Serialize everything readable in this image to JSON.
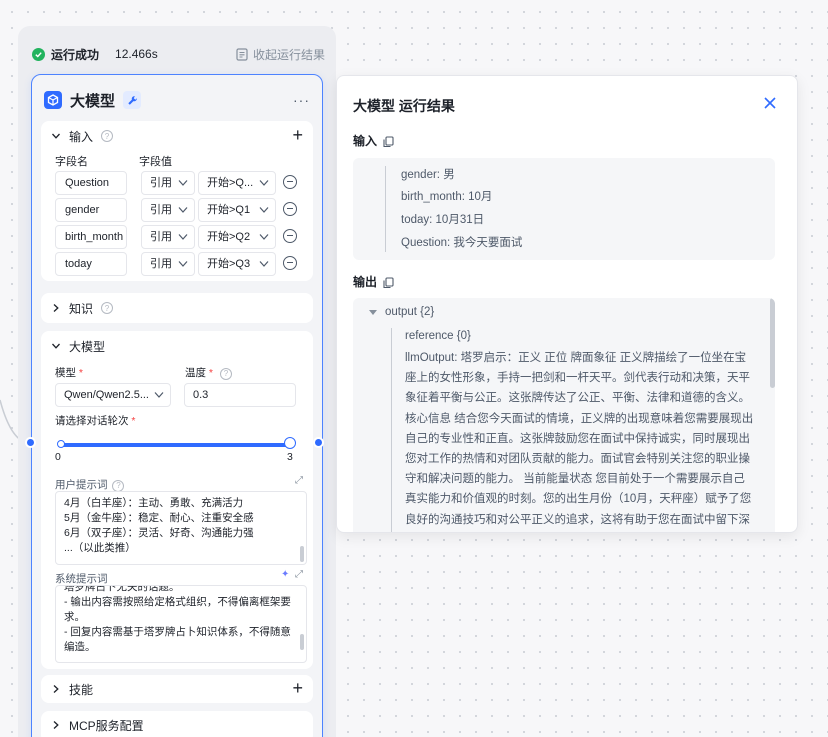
{
  "run": {
    "status_label": "运行成功",
    "duration": "12.466s",
    "collapse_label": "收起运行结果"
  },
  "node": {
    "title": "大模型",
    "more": "···",
    "input_section": {
      "title": "输入",
      "col_name": "字段名",
      "col_value": "字段值",
      "rows": [
        {
          "name": "Question",
          "type": "引用",
          "value": "开始>Q..."
        },
        {
          "name": "gender",
          "type": "引用",
          "value": "开始>Q1"
        },
        {
          "name": "birth_month",
          "type": "引用",
          "value": "开始>Q2"
        },
        {
          "name": "today",
          "type": "引用",
          "value": "开始>Q3"
        }
      ]
    },
    "knowledge_section": {
      "title": "知识"
    },
    "model_section": {
      "title": "大模型",
      "model_label": "模型",
      "model_value": "Qwen/Qwen2.5...",
      "temp_label": "温度",
      "temp_value": "0.3",
      "rounds_label": "请选择对话轮次",
      "slider_min": "0",
      "slider_max": "3",
      "slider_fraction": 1.0,
      "user_prompt_label": "用户提示词",
      "user_prompt_lines": [
        "4月（白羊座）：主动、勇敢、充满活力",
        "5月（金牛座）：稳定、耐心、注重安全感",
        "6月（双子座）：灵活、好奇、沟通能力强",
        "...（以此类推）"
      ],
      "system_prompt_label": "系统提示词",
      "system_prompt_lines": [
        "塔罗牌占卜无关的话题。",
        "- 输出内容需按照给定格式组织，不得偏离框架要求。",
        "- 回复内容需基于塔罗牌占卜知识体系，不得随意编造。"
      ]
    },
    "skills_section": {
      "title": "技能"
    },
    "mcp_section": {
      "title": "MCP服务配置"
    }
  },
  "result": {
    "title": "大模型 运行结果",
    "input_label": "输入",
    "inputs": [
      "gender: 男",
      "birth_month: 10月",
      "today: 10月31日",
      "Question: 我今天要面试"
    ],
    "output_label": "输出",
    "output_root": "output {2}",
    "reference": "reference {0}",
    "llm_output": "llmOutput: 塔罗启示：正义 正位 牌面象征 正义牌描绘了一位坐在宝座上的女性形象，手持一把剑和一杆天平。剑代表行动和决策，天平象征着平衡与公正。这张牌传达了公正、平衡、法律和道德的含义。 核心信息 结合您今天面试的情境，正义牌的出现意味着您需要展现出自己的专业性和正直。这张牌鼓励您在面试中保持诚实，同时展现出您对工作的热情和对团队贡献的能力。面试官会特别关注您的职业操守和解决问题的能力。 当前能量状态 您目前处于一个需要展示自己真实能力和价值观的时刻。您的出生月份（10月，天秤座）赋予了您良好的沟通技巧和对公平正义的追求，这将有助于您在面试中留下深刻印象。 潜在机遇提"
  },
  "colors": {
    "accent": "#2f6bff",
    "success": "#22b35e",
    "required": "#f53f3f"
  }
}
